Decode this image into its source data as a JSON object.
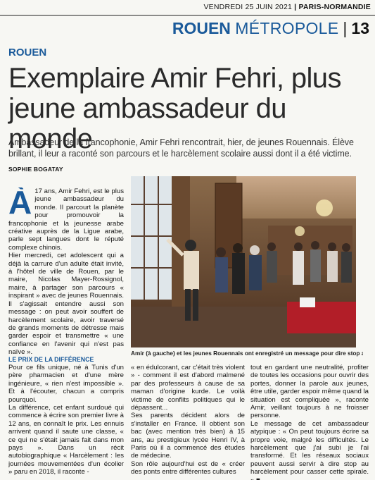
{
  "header": {
    "date": "VENDREDI 25 JUIN 2021",
    "sep": " | ",
    "paper": "PARIS-NORMANDIE",
    "section_city": "ROUEN",
    "section_sub": "MÉTROPOLE",
    "page_number": "13"
  },
  "article": {
    "kicker": "ROUEN",
    "headline": "Exemplaire Amir Fehri, plus jeune ambassadeur du monde",
    "standfirst": "Ambassadeur de la francophonie, Amir Fehri rencontrait, hier, de jeunes Rouennais. Élève brillant, il leur a raconté son parcours et le harcèlement scolaire aussi dont il a été victime.",
    "byline": "SOPHIE BOGATAY",
    "dropcap": "À",
    "col1a": [
      "17 ans, Amir Fehri, est le plus jeune ambassadeur du monde. Il parcourt la planète pour promouvoir la francophonie et la jeunesse arabe créative auprès de la Ligue arabe, parle sept langues dont le réputé complexe chinois.",
      "Hier mercredi, cet adolescent qui a déjà la carrure d'un adulte était invité, à l'hôtel de ville de Rouen, par le maire, Nicolas Mayer-Rossignol, maire, à partager son parcours « inspirant » avec de jeunes Rouennais. Il s'agissait entendre aussi son message : on peut avoir souffert de harcèlement scolaire, avoir traversé de grands moments de détresse mais garder espoir et transmettre « une confiance en l'avenir qui n'est pas naïve »."
    ],
    "subhead": "LE PRIX DE LA DIFFÉRENCE",
    "col1b": [
      "Pour ce fils unique, né à Tunis d'un père pharmacien et d'une mère ingénieure, « rien n'est impossible ». Et à l'écouter, chacun a compris pourquoi.",
      "La différence, cet enfant surdoué qui commence à écrire son premier livre à 12 ans, en connaît le prix. Les ennuis arrivent quand il saute une classe, « ce qui ne s'était jamais fait dans mon pays ». Dans un récit autobiographique « Harcèlement : les journées mouvementées d'un écolier » paru en 2018, il raconte -"
    ],
    "col2": [
      "« en édulcorant, car c'était très violent » - comment il est d'abord malmené par des professeurs à cause de sa maman d'origine kurde. Le voilà victime de conflits politiques qui le dépassent...",
      "Ses parents décident alors de s'installer en France. Il obtient son bac (avec mention très bien) à 15 ans, au prestigieux lycée Henri IV, à Paris où il a commencé des études de médecine.",
      "Son rôle aujourd'hui est de « créer des ponts entre différentes cultures"
    ],
    "col3": [
      "tout en gardant une neutralité, profiter de toutes les occasions pour ouvrir des portes, donner la parole aux jeunes, être utile, garder espoir même quand la situation est compliquée », raconte Amir, veillant toujours à ne froisser personne.",
      "Le message de cet ambassadeur atypique : « On peut toujours écrire sa propre voie, malgré les difficultés. Le harcèlement que j'ai subi je l'ai transformé. Et les réseaux sociaux peuvent aussi servir à dire stop au harcèlement pour casser cette spirale. » ■"
    ],
    "caption": "Amir (à gauche) et les jeunes Rouennais ont enregistré un message pour dire stop au harcèlement"
  }
}
